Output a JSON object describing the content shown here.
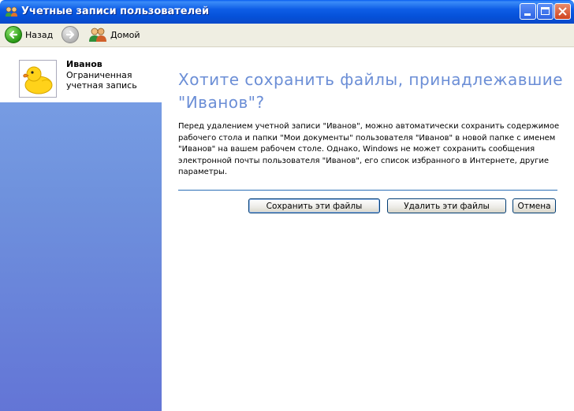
{
  "window": {
    "title": "Учетные записи пользователей"
  },
  "toolbar": {
    "back_label": "Назад",
    "home_label": "Домой"
  },
  "user": {
    "name": "Иванов",
    "type": "Ограниченная учетная запись",
    "avatar": "rubber-duck"
  },
  "main": {
    "heading": "Хотите сохранить файлы, принадлежавшие \"Иванов\"?",
    "description": "Перед удалением учетной записи \"Иванов\", можно автоматически сохранить содержимое рабочего стола и папки \"Мои документы\" пользователя \"Иванов\" в новой папке с именем \"Иванов\" на вашем рабочем столе. Однако, Windows не может сохранить сообщения электронной почты пользователя \"Иванов\", его список избранного в Интернете, другие параметры.",
    "buttons": {
      "save": "Сохранить эти файлы",
      "delete": "Удалить эти файлы",
      "cancel": "Отмена"
    }
  },
  "colors": {
    "heading": "#6b8ed6",
    "titlebar": "#0551d9",
    "panel": "#6f92dd"
  }
}
